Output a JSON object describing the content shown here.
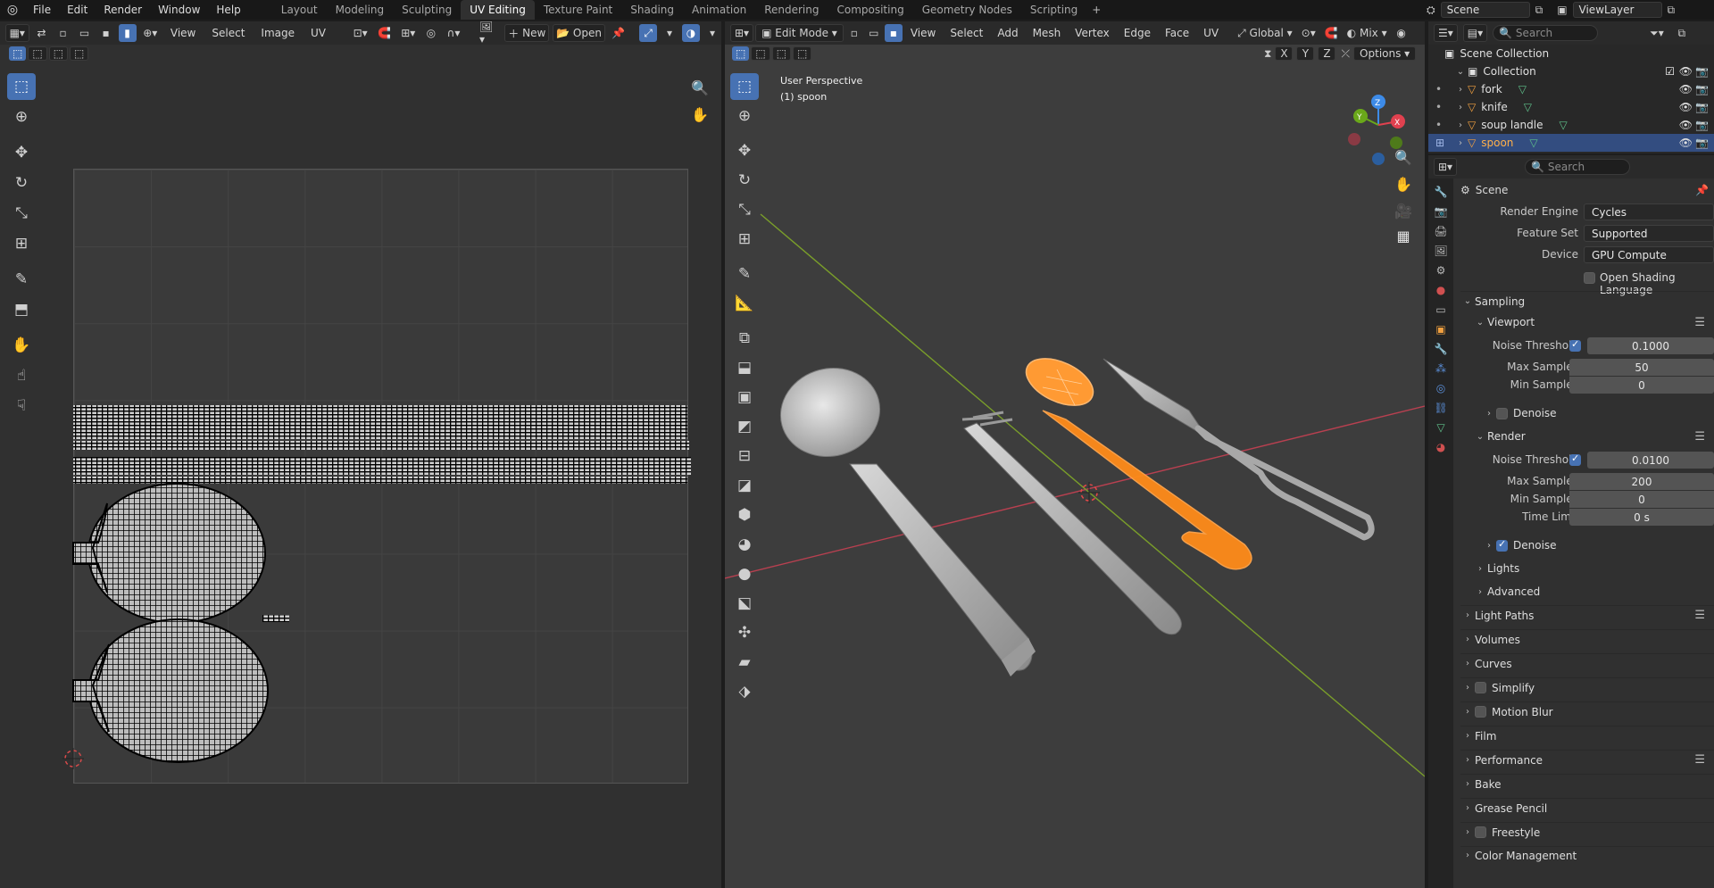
{
  "topbar": {
    "menu": [
      "File",
      "Edit",
      "Render",
      "Window",
      "Help"
    ],
    "workspaces": [
      "Layout",
      "Modeling",
      "Sculpting",
      "UV Editing",
      "Texture Paint",
      "Shading",
      "Animation",
      "Rendering",
      "Compositing",
      "Geometry Nodes",
      "Scripting"
    ],
    "active_workspace": "UV Editing",
    "scene": "Scene",
    "view_layer": "ViewLayer"
  },
  "uv_editor": {
    "menus": [
      "View",
      "Select",
      "Image",
      "UV"
    ],
    "new_label": "New",
    "open_label": "Open"
  },
  "viewport": {
    "mode": "Edit Mode",
    "menus": [
      "View",
      "Select",
      "Add",
      "Mesh",
      "Vertex",
      "Edge",
      "Face",
      "UV"
    ],
    "transform_orientation": "Global",
    "shading_mix": "Mix",
    "options_label": "Options",
    "axes": [
      "X",
      "Y",
      "Z"
    ],
    "overlay_line1": "User Perspective",
    "overlay_line2": "(1) spoon",
    "gizmo_axes": {
      "x": "X",
      "y": "Y",
      "z": "Z"
    }
  },
  "outliner": {
    "search_placeholder": "Search",
    "root": "Scene Collection",
    "collection": "Collection",
    "items": [
      {
        "name": "fork",
        "selected": false
      },
      {
        "name": "knife",
        "selected": false
      },
      {
        "name": "soup landle",
        "selected": false
      },
      {
        "name": "spoon",
        "selected": true
      }
    ]
  },
  "properties": {
    "search_placeholder": "Search",
    "context": "Scene",
    "render_engine": {
      "label": "Render Engine",
      "value": "Cycles"
    },
    "feature_set": {
      "label": "Feature Set",
      "value": "Supported"
    },
    "device": {
      "label": "Device",
      "value": "GPU Compute"
    },
    "osl": {
      "label": "Open Shading Language",
      "checked": false
    },
    "sampling": "Sampling",
    "viewport": {
      "title": "Viewport",
      "noise_threshold_label": "Noise Threshold",
      "noise_threshold": "0.1000",
      "max_samples_label": "Max Samples",
      "max_samples": "50",
      "min_samples_label": "Min Samples",
      "min_samples": "0",
      "denoise": "Denoise"
    },
    "render": {
      "title": "Render",
      "noise_threshold_label": "Noise Threshold",
      "noise_threshold": "0.0100",
      "max_samples_label": "Max Samples",
      "max_samples": "200",
      "min_samples_label": "Min Samples",
      "min_samples": "0",
      "time_limit_label": "Time Limit",
      "time_limit": "0 s",
      "denoise": "Denoise"
    },
    "lights": "Lights",
    "advanced": "Advanced",
    "panels": [
      "Light Paths",
      "Volumes",
      "Curves",
      "Simplify",
      "Motion Blur",
      "Film",
      "Performance",
      "Bake",
      "Grease Pencil",
      "Freestyle",
      "Color Management"
    ]
  },
  "colors": {
    "accent": "#4772b3",
    "selected_object": "#ff8c1a",
    "x_axis": "#e0414f",
    "y_axis": "#6aa81a",
    "z_axis": "#3d8be8"
  }
}
